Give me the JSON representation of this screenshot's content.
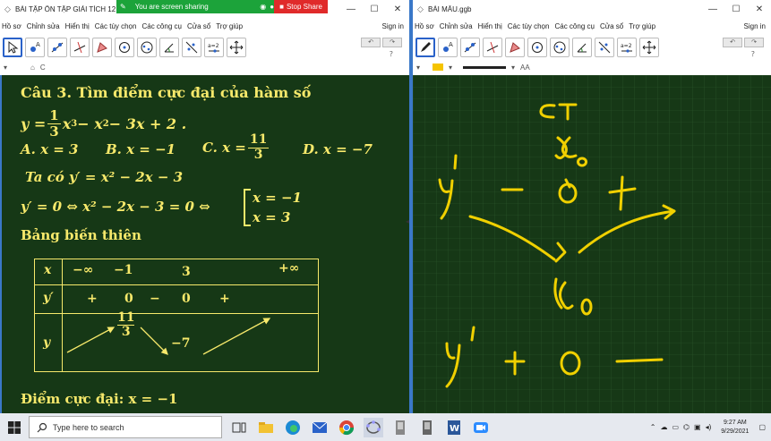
{
  "share_bar": {
    "status": "You are screen sharing",
    "stop_label": "Stop Share"
  },
  "left_window": {
    "title": "BÀI TẬP ÔN TẬP GIẢI TÍCH 12.ggb",
    "menu": [
      "Hồ sơ",
      "Chỉnh sửa",
      "Hiển thị",
      "Các tùy chọn",
      "Các công cụ",
      "Cửa sổ",
      "Trợ giúp"
    ],
    "sign_in": "Sign in",
    "help": "?",
    "tools": [
      "move-tool",
      "point-tool",
      "line-tool",
      "perpendicular-tool",
      "polygon-tool",
      "circle-tool",
      "ellipse-tool",
      "angle-tool",
      "reflect-tool",
      "slider-tool",
      "move-view-tool"
    ],
    "slider_tool_label": "a=2",
    "style_label": "C",
    "content": {
      "q_prefix": "Câu 3.",
      "q_text": "Tìm điểm cực đại của hàm số",
      "eq_y": "y =",
      "eq_frac_n": "1",
      "eq_frac_d": "3",
      "eq_rest_a": "x",
      "eq_rest_b": "3",
      "eq_rest_c": " − x",
      "eq_rest_d": "2",
      "eq_rest_e": " − 3x + 2 .",
      "ans_a": "A. x = 3",
      "ans_b": "B. x = −1",
      "ans_c_pre": "C. x =",
      "ans_c_n": "11",
      "ans_c_d": "3",
      "ans_d": "D. x = −7",
      "deriv_line": "Ta có y′ = x² − 2x − 3",
      "zero_line": "y′ = 0 ⇔ x² − 2x − 3 = 0  ⇔",
      "root1": "x = −1",
      "root2": "x = 3",
      "table_title": "Bảng biến thiên",
      "table": {
        "x_label": "x",
        "x_vals": [
          "−∞",
          "−1",
          "3",
          "+∞"
        ],
        "yp_label": "y′",
        "yp_vals": [
          "+",
          "0",
          "−",
          "0",
          "+"
        ],
        "y_label": "y",
        "y_max_n": "11",
        "y_max_d": "3",
        "y_min": "−7"
      },
      "conclusion": "Điểm cực đại: x = −1"
    }
  },
  "right_window": {
    "title": "BÀI MẪU.ggb",
    "menu": [
      "Hồ sơ",
      "Chỉnh sửa",
      "Hiển thị",
      "Các tùy chọn",
      "Các công cụ",
      "Cửa sổ",
      "Trợ giúp"
    ],
    "sign_in": "Sign in",
    "help": "?",
    "tools": [
      "pen-tool",
      "point-tool",
      "line-tool",
      "perpendicular-tool",
      "polygon-tool",
      "circle-tool",
      "ellipse-tool",
      "angle-tool",
      "reflect-tool",
      "slider-tool",
      "move-view-tool"
    ],
    "slider_tool_label": "a=2",
    "style_label": "AA"
  },
  "taskbar": {
    "search_placeholder": "Type here to search",
    "time": "9:27 AM",
    "date": "9/29/2021",
    "apps": [
      "task-view",
      "file-explorer",
      "edge",
      "mail",
      "chrome",
      "geogebra",
      "app-a",
      "app-b",
      "word",
      "zoom"
    ]
  },
  "colors": {
    "chalk": "#f7e96b",
    "board": "#163816",
    "accent": "#3a78c8",
    "grid": "#2d5a2d"
  }
}
